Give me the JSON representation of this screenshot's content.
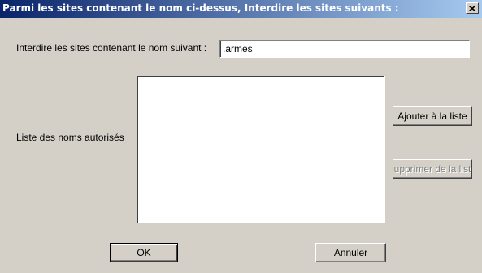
{
  "window": {
    "title": "Parmi les sites contenant le nom ci-dessus, Interdire les sites suivants :",
    "close_icon": "close-icon"
  },
  "form": {
    "name_label": "Interdire les sites contenant le nom suivant :",
    "name_value": ".armes",
    "list_label": "Liste des noms autorisés",
    "list_items": []
  },
  "buttons": {
    "add": "Ajouter à la liste",
    "remove": "upprimer de la list",
    "ok": "OK",
    "cancel": "Annuler"
  }
}
